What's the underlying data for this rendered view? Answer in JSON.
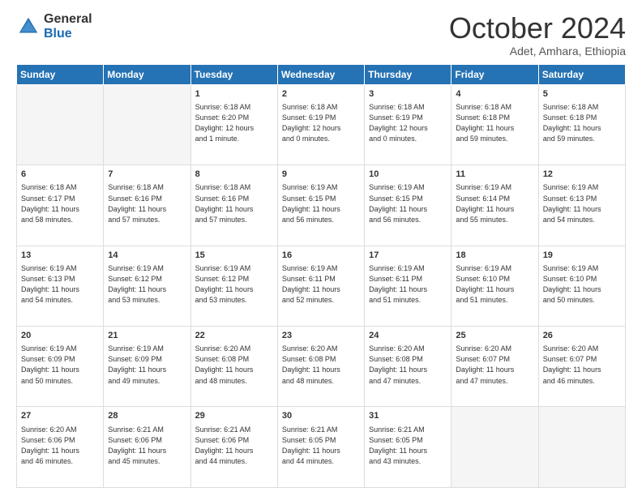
{
  "logo": {
    "general": "General",
    "blue": "Blue"
  },
  "header": {
    "month": "October 2024",
    "location": "Adet, Amhara, Ethiopia"
  },
  "days_of_week": [
    "Sunday",
    "Monday",
    "Tuesday",
    "Wednesday",
    "Thursday",
    "Friday",
    "Saturday"
  ],
  "weeks": [
    [
      {
        "day": "",
        "info": ""
      },
      {
        "day": "",
        "info": ""
      },
      {
        "day": "1",
        "info": "Sunrise: 6:18 AM\nSunset: 6:20 PM\nDaylight: 12 hours\nand 1 minute."
      },
      {
        "day": "2",
        "info": "Sunrise: 6:18 AM\nSunset: 6:19 PM\nDaylight: 12 hours\nand 0 minutes."
      },
      {
        "day": "3",
        "info": "Sunrise: 6:18 AM\nSunset: 6:19 PM\nDaylight: 12 hours\nand 0 minutes."
      },
      {
        "day": "4",
        "info": "Sunrise: 6:18 AM\nSunset: 6:18 PM\nDaylight: 11 hours\nand 59 minutes."
      },
      {
        "day": "5",
        "info": "Sunrise: 6:18 AM\nSunset: 6:18 PM\nDaylight: 11 hours\nand 59 minutes."
      }
    ],
    [
      {
        "day": "6",
        "info": "Sunrise: 6:18 AM\nSunset: 6:17 PM\nDaylight: 11 hours\nand 58 minutes."
      },
      {
        "day": "7",
        "info": "Sunrise: 6:18 AM\nSunset: 6:16 PM\nDaylight: 11 hours\nand 57 minutes."
      },
      {
        "day": "8",
        "info": "Sunrise: 6:18 AM\nSunset: 6:16 PM\nDaylight: 11 hours\nand 57 minutes."
      },
      {
        "day": "9",
        "info": "Sunrise: 6:19 AM\nSunset: 6:15 PM\nDaylight: 11 hours\nand 56 minutes."
      },
      {
        "day": "10",
        "info": "Sunrise: 6:19 AM\nSunset: 6:15 PM\nDaylight: 11 hours\nand 56 minutes."
      },
      {
        "day": "11",
        "info": "Sunrise: 6:19 AM\nSunset: 6:14 PM\nDaylight: 11 hours\nand 55 minutes."
      },
      {
        "day": "12",
        "info": "Sunrise: 6:19 AM\nSunset: 6:13 PM\nDaylight: 11 hours\nand 54 minutes."
      }
    ],
    [
      {
        "day": "13",
        "info": "Sunrise: 6:19 AM\nSunset: 6:13 PM\nDaylight: 11 hours\nand 54 minutes."
      },
      {
        "day": "14",
        "info": "Sunrise: 6:19 AM\nSunset: 6:12 PM\nDaylight: 11 hours\nand 53 minutes."
      },
      {
        "day": "15",
        "info": "Sunrise: 6:19 AM\nSunset: 6:12 PM\nDaylight: 11 hours\nand 53 minutes."
      },
      {
        "day": "16",
        "info": "Sunrise: 6:19 AM\nSunset: 6:11 PM\nDaylight: 11 hours\nand 52 minutes."
      },
      {
        "day": "17",
        "info": "Sunrise: 6:19 AM\nSunset: 6:11 PM\nDaylight: 11 hours\nand 51 minutes."
      },
      {
        "day": "18",
        "info": "Sunrise: 6:19 AM\nSunset: 6:10 PM\nDaylight: 11 hours\nand 51 minutes."
      },
      {
        "day": "19",
        "info": "Sunrise: 6:19 AM\nSunset: 6:10 PM\nDaylight: 11 hours\nand 50 minutes."
      }
    ],
    [
      {
        "day": "20",
        "info": "Sunrise: 6:19 AM\nSunset: 6:09 PM\nDaylight: 11 hours\nand 50 minutes."
      },
      {
        "day": "21",
        "info": "Sunrise: 6:19 AM\nSunset: 6:09 PM\nDaylight: 11 hours\nand 49 minutes."
      },
      {
        "day": "22",
        "info": "Sunrise: 6:20 AM\nSunset: 6:08 PM\nDaylight: 11 hours\nand 48 minutes."
      },
      {
        "day": "23",
        "info": "Sunrise: 6:20 AM\nSunset: 6:08 PM\nDaylight: 11 hours\nand 48 minutes."
      },
      {
        "day": "24",
        "info": "Sunrise: 6:20 AM\nSunset: 6:08 PM\nDaylight: 11 hours\nand 47 minutes."
      },
      {
        "day": "25",
        "info": "Sunrise: 6:20 AM\nSunset: 6:07 PM\nDaylight: 11 hours\nand 47 minutes."
      },
      {
        "day": "26",
        "info": "Sunrise: 6:20 AM\nSunset: 6:07 PM\nDaylight: 11 hours\nand 46 minutes."
      }
    ],
    [
      {
        "day": "27",
        "info": "Sunrise: 6:20 AM\nSunset: 6:06 PM\nDaylight: 11 hours\nand 46 minutes."
      },
      {
        "day": "28",
        "info": "Sunrise: 6:21 AM\nSunset: 6:06 PM\nDaylight: 11 hours\nand 45 minutes."
      },
      {
        "day": "29",
        "info": "Sunrise: 6:21 AM\nSunset: 6:06 PM\nDaylight: 11 hours\nand 44 minutes."
      },
      {
        "day": "30",
        "info": "Sunrise: 6:21 AM\nSunset: 6:05 PM\nDaylight: 11 hours\nand 44 minutes."
      },
      {
        "day": "31",
        "info": "Sunrise: 6:21 AM\nSunset: 6:05 PM\nDaylight: 11 hours\nand 43 minutes."
      },
      {
        "day": "",
        "info": ""
      },
      {
        "day": "",
        "info": ""
      }
    ]
  ]
}
